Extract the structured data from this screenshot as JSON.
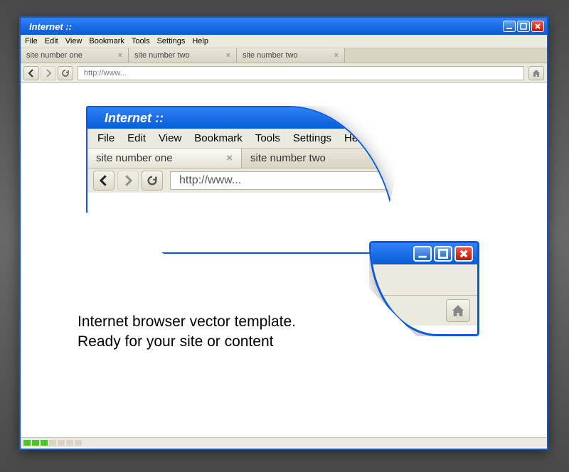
{
  "window": {
    "title": "Internet ::"
  },
  "menu": {
    "file": "File",
    "edit": "Edit",
    "view": "View",
    "bookmark": "Bookmark",
    "tools": "Tools",
    "settings": "Settings",
    "help": "Help"
  },
  "tabs": [
    {
      "label": "site number one"
    },
    {
      "label": "site number two"
    },
    {
      "label": "site number two"
    }
  ],
  "url": "http://www...",
  "zoom_top": {
    "title": "Internet ::",
    "tab1": "site number one",
    "tab2": "site number two",
    "url": "http://www..."
  },
  "caption": {
    "line1": "Internet browser vector template.",
    "line2": "Ready for your site or content"
  }
}
